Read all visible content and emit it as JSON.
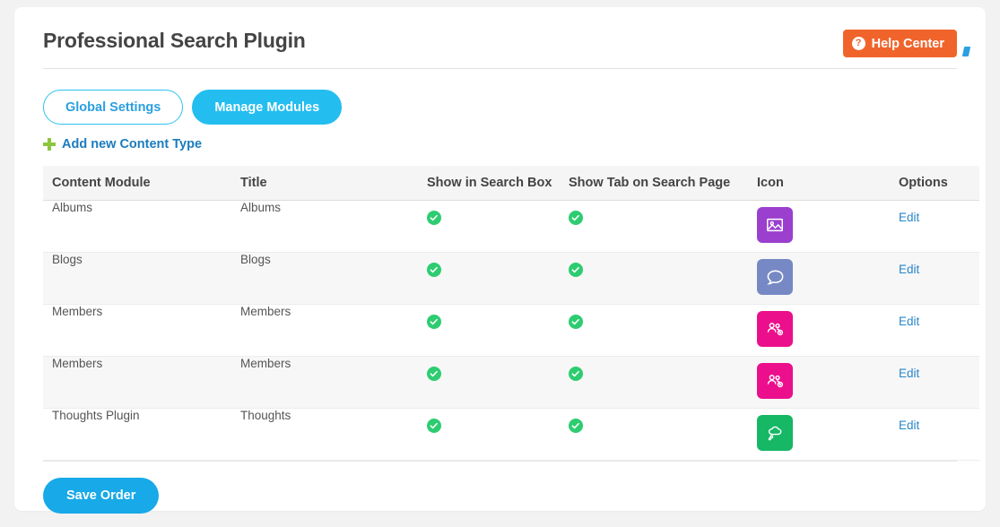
{
  "header": {
    "title": "Professional Search Plugin",
    "help_button": {
      "label": "Help Center",
      "icon": "question-circle-icon",
      "color": "#f0642c"
    }
  },
  "tabs": [
    {
      "label": "Global Settings",
      "active": false
    },
    {
      "label": "Manage Modules",
      "active": true
    }
  ],
  "add_link": {
    "label": "Add new Content Type",
    "icon": "plus-icon",
    "color": "#1a7cbd"
  },
  "table": {
    "columns": [
      "Content Module",
      "Title",
      "Show in Search Box",
      "Show Tab on Search Page",
      "Icon",
      "Options"
    ],
    "rows": [
      {
        "module": "Albums",
        "title": "Albums",
        "show_in_search_box": true,
        "show_tab_on_search_page": true,
        "icon": {
          "name": "image-icon",
          "color": "#9b3fce"
        },
        "option_label": "Edit"
      },
      {
        "module": "Blogs",
        "title": "Blogs",
        "show_in_search_box": true,
        "show_tab_on_search_page": true,
        "icon": {
          "name": "speech-bubble-icon",
          "color": "#7689c4"
        },
        "option_label": "Edit"
      },
      {
        "module": "Members",
        "title": "Members",
        "show_in_search_box": true,
        "show_tab_on_search_page": true,
        "icon": {
          "name": "users-icon",
          "color": "#ec0f8c"
        },
        "option_label": "Edit"
      },
      {
        "module": "Members",
        "title": "Members",
        "show_in_search_box": true,
        "show_tab_on_search_page": true,
        "icon": {
          "name": "users-icon",
          "color": "#ec0f8c"
        },
        "option_label": "Edit"
      },
      {
        "module": "Thoughts Plugin",
        "title": "Thoughts",
        "show_in_search_box": true,
        "show_tab_on_search_page": true,
        "icon": {
          "name": "thought-bubble-icon",
          "color": "#16b765"
        },
        "option_label": "Edit"
      }
    ]
  },
  "footer": {
    "save_label": "Save Order"
  },
  "colors": {
    "accent_cyan": "#24bdf0",
    "help_orange": "#f0642c",
    "check_green": "#2ecc71",
    "link_blue": "#2a86c8",
    "page_background": "#f2f2f2"
  }
}
